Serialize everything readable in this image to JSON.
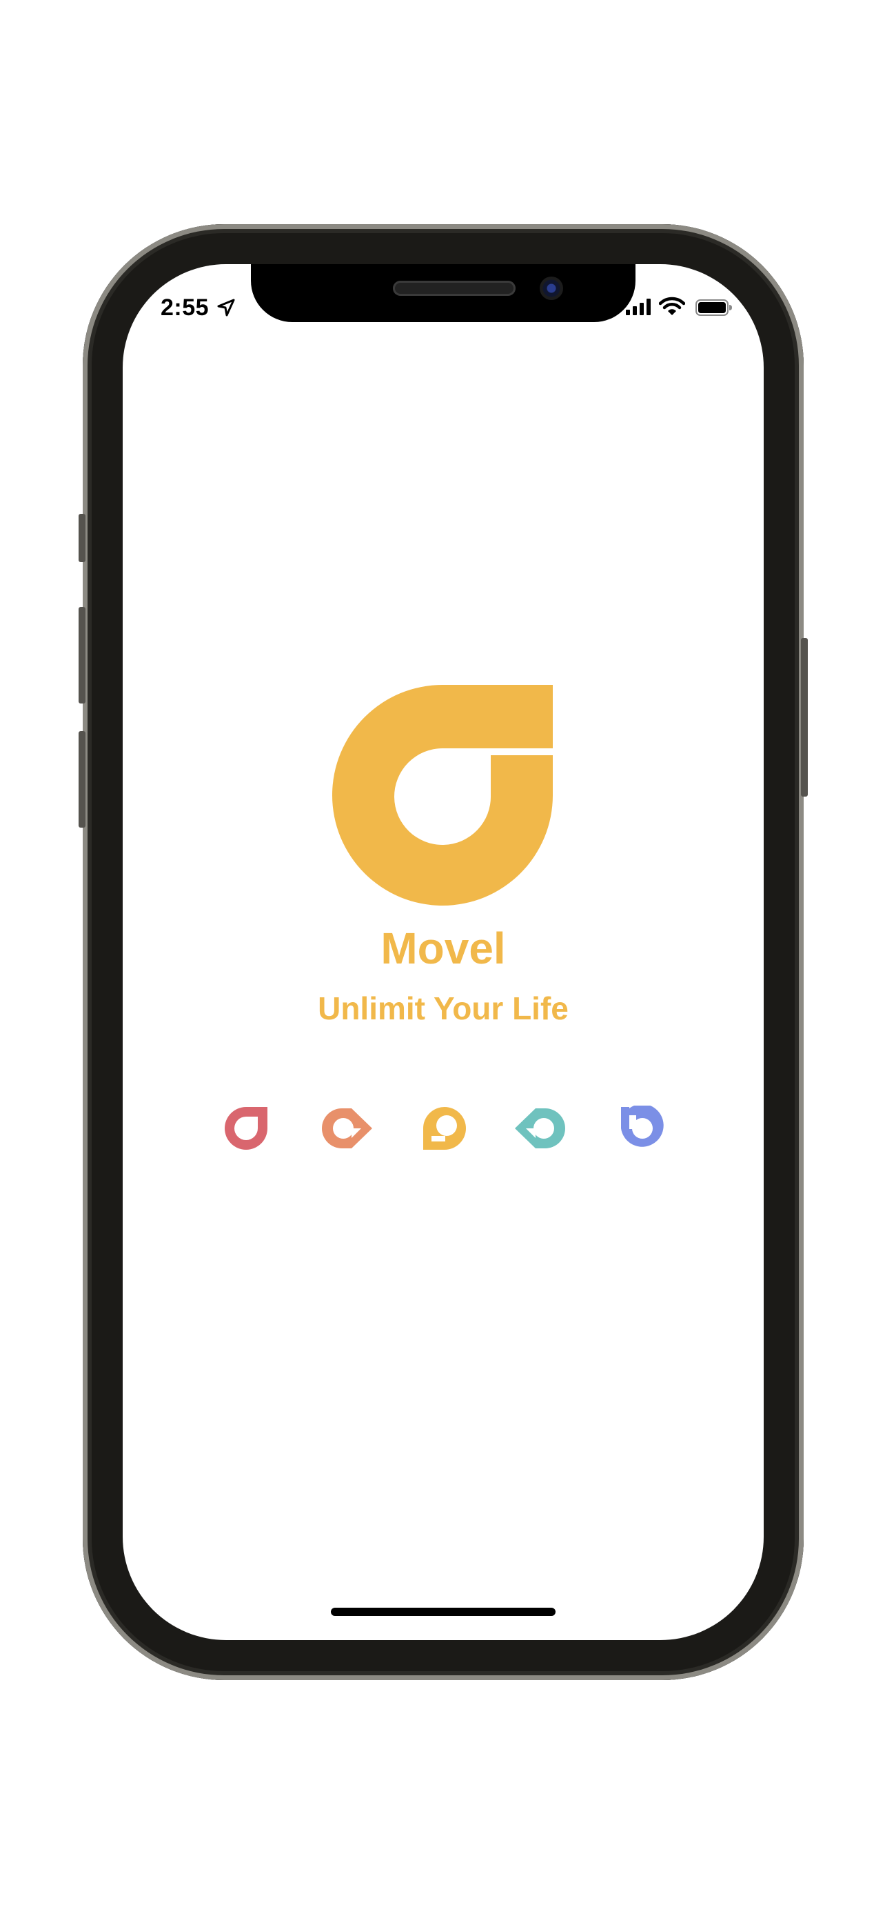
{
  "status_bar": {
    "time": "2:55",
    "icons": [
      "location-arrow-icon",
      "cellular-signal-icon",
      "wifi-icon",
      "battery-icon"
    ]
  },
  "splash": {
    "app_name": "Movel",
    "tagline": "Unlimit Your Life",
    "logo_icon": "movel-logo-icon",
    "brand_color": "#F1B84A",
    "variant_icons": [
      {
        "name": "red-logo-variant-icon",
        "color": "#D9666E"
      },
      {
        "name": "orange-logo-variant-icon",
        "color": "#E8906A"
      },
      {
        "name": "yellow-logo-variant-icon",
        "color": "#F1B84A"
      },
      {
        "name": "teal-logo-variant-icon",
        "color": "#6FC2BE"
      },
      {
        "name": "blue-logo-variant-icon",
        "color": "#7B8FE6"
      }
    ]
  }
}
